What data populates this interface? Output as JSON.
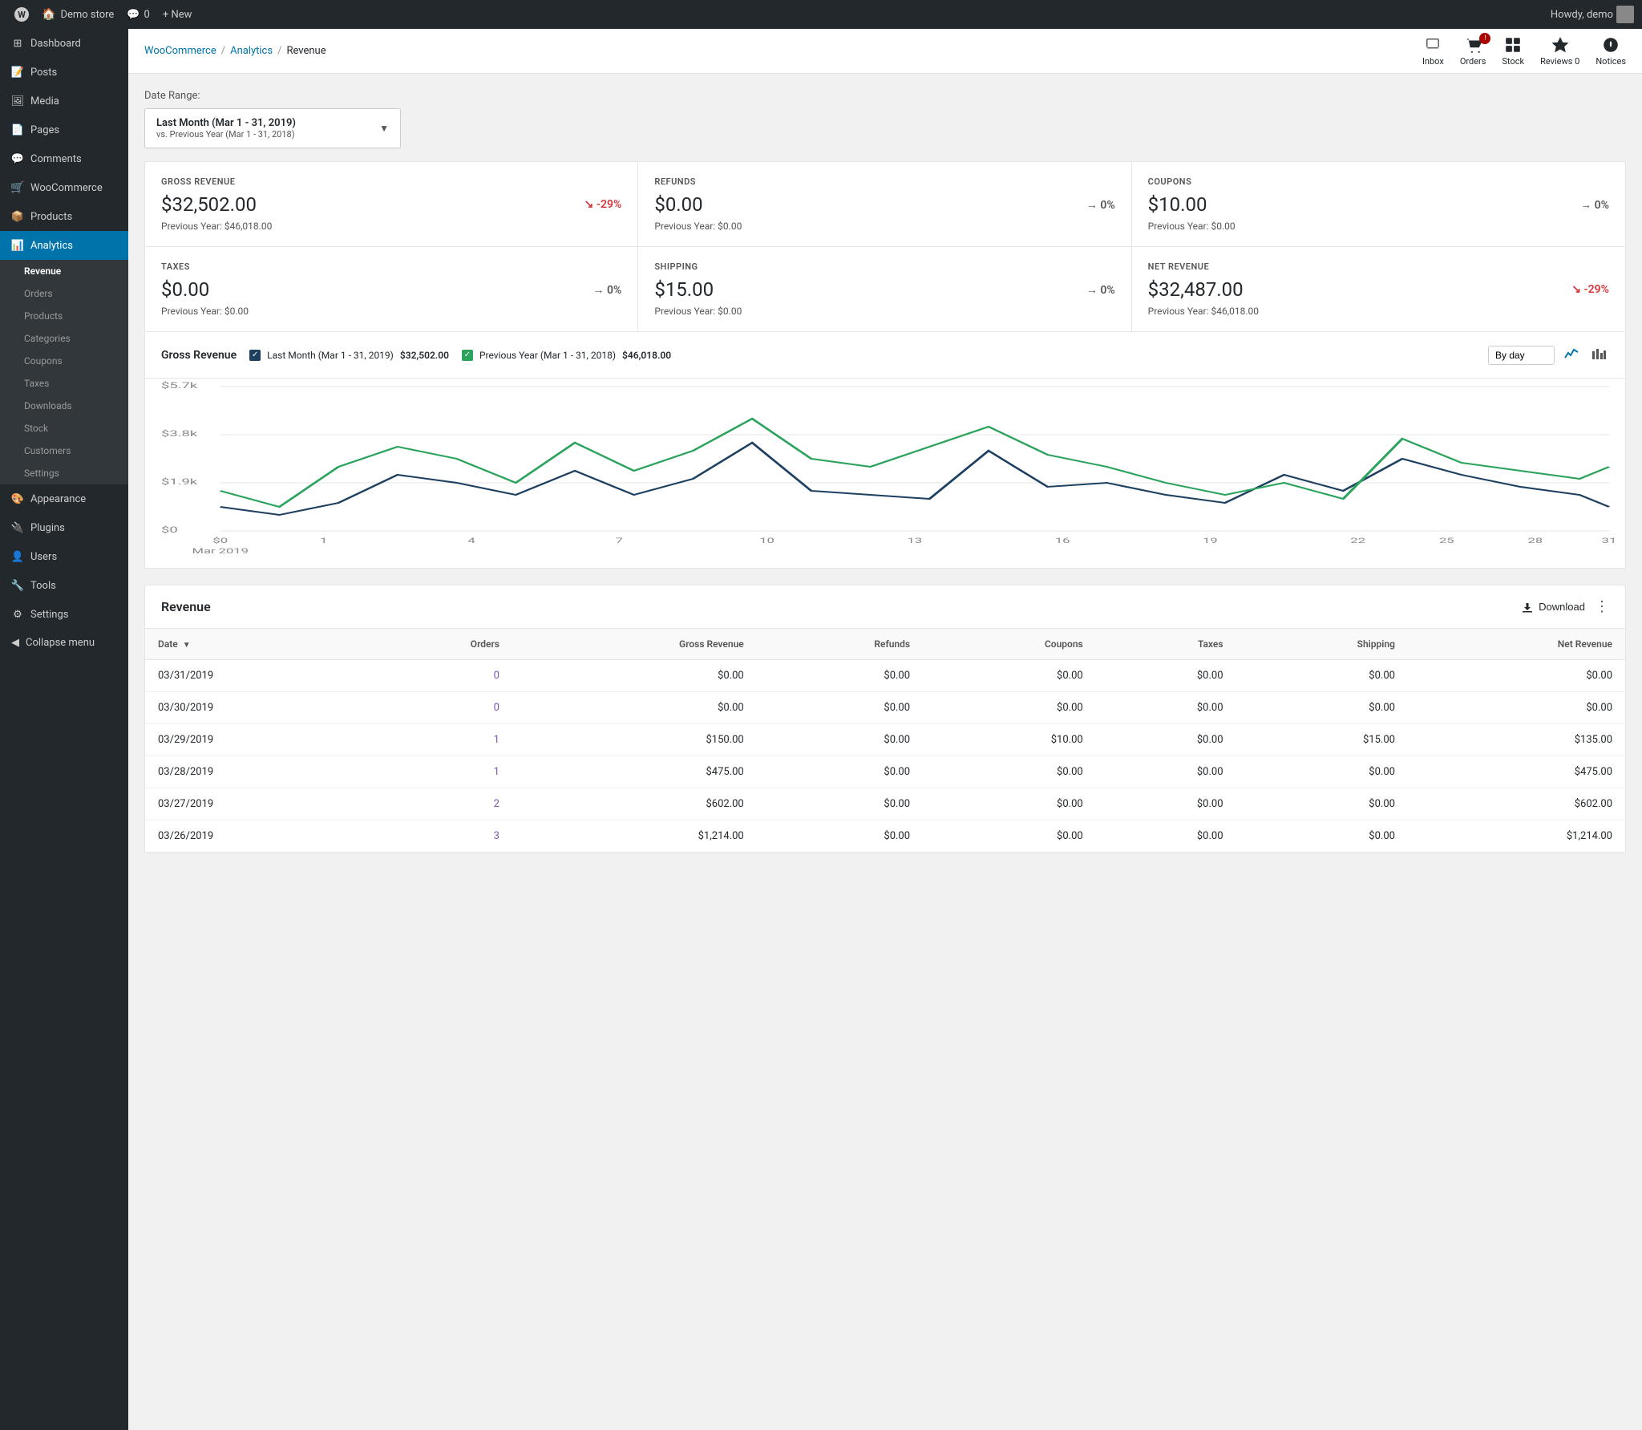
{
  "adminbar": {
    "site_icon": "W",
    "site_name": "Demo store",
    "comments_count": "0",
    "new_label": "+ New",
    "howdy": "Howdy, demo"
  },
  "sidebar": {
    "menu_items": [
      {
        "id": "dashboard",
        "label": "Dashboard",
        "icon": "dashboard",
        "active": false
      },
      {
        "id": "posts",
        "label": "Posts",
        "icon": "posts",
        "active": false
      },
      {
        "id": "media",
        "label": "Media",
        "icon": "media",
        "active": false
      },
      {
        "id": "pages",
        "label": "Pages",
        "icon": "pages",
        "active": false
      },
      {
        "id": "comments",
        "label": "Comments",
        "icon": "comments",
        "active": false
      },
      {
        "id": "woocommerce",
        "label": "WooCommerce",
        "icon": "woo",
        "active": false
      },
      {
        "id": "products",
        "label": "Products",
        "icon": "products",
        "active": false
      },
      {
        "id": "analytics",
        "label": "Analytics",
        "icon": "analytics",
        "active": true
      }
    ],
    "analytics_submenu": [
      {
        "id": "revenue",
        "label": "Revenue",
        "active": true
      },
      {
        "id": "orders",
        "label": "Orders",
        "active": false
      },
      {
        "id": "products",
        "label": "Products",
        "active": false
      },
      {
        "id": "categories",
        "label": "Categories",
        "active": false
      },
      {
        "id": "coupons",
        "label": "Coupons",
        "active": false
      },
      {
        "id": "taxes",
        "label": "Taxes",
        "active": false
      },
      {
        "id": "downloads",
        "label": "Downloads",
        "active": false
      },
      {
        "id": "stock",
        "label": "Stock",
        "active": false
      },
      {
        "id": "customers",
        "label": "Customers",
        "active": false
      },
      {
        "id": "settings",
        "label": "Settings",
        "active": false
      }
    ],
    "bottom_items": [
      {
        "id": "appearance",
        "label": "Appearance",
        "icon": "appearance"
      },
      {
        "id": "plugins",
        "label": "Plugins",
        "icon": "plugins"
      },
      {
        "id": "users",
        "label": "Users",
        "icon": "users"
      },
      {
        "id": "tools",
        "label": "Tools",
        "icon": "tools"
      },
      {
        "id": "settings",
        "label": "Settings",
        "icon": "settings"
      }
    ],
    "collapse_label": "Collapse menu"
  },
  "topbar": {
    "icons": [
      {
        "id": "inbox",
        "label": "Inbox",
        "icon": "inbox"
      },
      {
        "id": "orders",
        "label": "Orders",
        "icon": "orders",
        "badge": "!"
      },
      {
        "id": "stock",
        "label": "Stock",
        "icon": "stock"
      },
      {
        "id": "reviews",
        "label": "Reviews 0",
        "icon": "reviews"
      },
      {
        "id": "notices",
        "label": "Notices",
        "icon": "notices"
      }
    ]
  },
  "breadcrumb": {
    "items": [
      {
        "label": "WooCommerce",
        "href": "#"
      },
      {
        "label": "Analytics",
        "href": "#"
      },
      {
        "label": "Revenue",
        "current": true
      }
    ]
  },
  "date_range": {
    "label": "Date Range:",
    "main": "Last Month (Mar 1 - 31, 2019)",
    "compare": "vs. Previous Year (Mar 1 - 31, 2018)"
  },
  "stats": {
    "cards": [
      {
        "id": "gross-revenue",
        "label": "GROSS REVENUE",
        "value": "$32,502.00",
        "change": "-29%",
        "change_type": "negative",
        "change_icon": "↘",
        "prev_label": "Previous Year: $46,018.00"
      },
      {
        "id": "refunds",
        "label": "REFUNDS",
        "value": "$0.00",
        "change": "0%",
        "change_type": "neutral",
        "change_icon": "→",
        "prev_label": "Previous Year: $0.00"
      },
      {
        "id": "coupons",
        "label": "COUPONS",
        "value": "$10.00",
        "change": "0%",
        "change_type": "neutral",
        "change_icon": "→",
        "prev_label": "Previous Year: $0.00"
      },
      {
        "id": "taxes",
        "label": "TAXES",
        "value": "$0.00",
        "change": "0%",
        "change_type": "neutral",
        "change_icon": "→",
        "prev_label": "Previous Year: $0.00"
      },
      {
        "id": "shipping",
        "label": "SHIPPING",
        "value": "$15.00",
        "change": "0%",
        "change_type": "neutral",
        "change_icon": "→",
        "prev_label": "Previous Year: $0.00"
      },
      {
        "id": "net-revenue",
        "label": "NET REVENUE",
        "value": "$32,487.00",
        "change": "-29%",
        "change_type": "negative",
        "change_icon": "↘",
        "prev_label": "Previous Year: $46,018.00"
      }
    ]
  },
  "chart": {
    "title": "Gross Revenue",
    "legend": [
      {
        "id": "current",
        "label": "Last Month (Mar 1 - 31, 2019)",
        "amount": "$32,502.00",
        "color": "blue",
        "check": "✓"
      },
      {
        "id": "prev",
        "label": "Previous Year (Mar 1 - 31, 2018)",
        "amount": "$46,018.00",
        "color": "green",
        "check": "✓"
      }
    ],
    "by_day_label": "By day",
    "y_labels": [
      "$5.7k",
      "$3.8k",
      "$1.9k",
      "$0"
    ],
    "x_labels": [
      "Mar 2019",
      "1",
      "4",
      "7",
      "10",
      "13",
      "16",
      "19",
      "22",
      "25",
      "28",
      "31"
    ]
  },
  "table": {
    "title": "Revenue",
    "download_label": "Download",
    "columns": [
      "Date",
      "Orders",
      "Gross Revenue",
      "Refunds",
      "Coupons",
      "Taxes",
      "Shipping",
      "Net Revenue"
    ],
    "rows": [
      {
        "date": "03/31/2019",
        "orders": "0",
        "gross": "$0.00",
        "refunds": "$0.00",
        "coupons": "$0.00",
        "taxes": "$0.00",
        "shipping": "$0.00",
        "net": "$0.00"
      },
      {
        "date": "03/30/2019",
        "orders": "0",
        "gross": "$0.00",
        "refunds": "$0.00",
        "coupons": "$0.00",
        "taxes": "$0.00",
        "shipping": "$0.00",
        "net": "$0.00"
      },
      {
        "date": "03/29/2019",
        "orders": "1",
        "gross": "$150.00",
        "refunds": "$0.00",
        "coupons": "$10.00",
        "taxes": "$0.00",
        "shipping": "$15.00",
        "net": "$135.00"
      },
      {
        "date": "03/28/2019",
        "orders": "1",
        "gross": "$475.00",
        "refunds": "$0.00",
        "coupons": "$0.00",
        "taxes": "$0.00",
        "shipping": "$0.00",
        "net": "$475.00"
      },
      {
        "date": "03/27/2019",
        "orders": "2",
        "gross": "$602.00",
        "refunds": "$0.00",
        "coupons": "$0.00",
        "taxes": "$0.00",
        "shipping": "$0.00",
        "net": "$602.00"
      },
      {
        "date": "03/26/2019",
        "orders": "3",
        "gross": "$1,214.00",
        "refunds": "$0.00",
        "coupons": "$0.00",
        "taxes": "$0.00",
        "shipping": "$0.00",
        "net": "$1,214.00"
      }
    ]
  }
}
